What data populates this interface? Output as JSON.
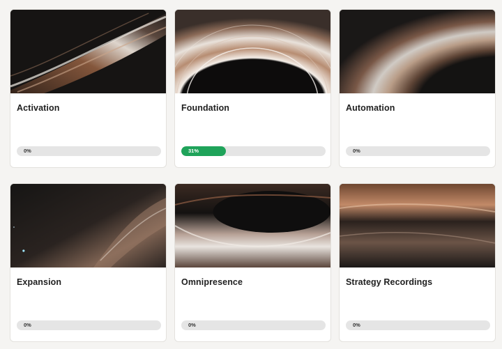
{
  "colors": {
    "page_background": "#f5f4f2",
    "card_background": "#ffffff",
    "progress_track": "#e5e5e5",
    "progress_fill": "#1fa35a"
  },
  "courses": [
    {
      "title": "Activation",
      "progress_label": "0%",
      "progress": 0,
      "thumbnail_icon": "black-hole-image"
    },
    {
      "title": "Foundation",
      "progress_label": "31%",
      "progress": 31,
      "thumbnail_icon": "black-hole-image"
    },
    {
      "title": "Automation",
      "progress_label": "0%",
      "progress": 0,
      "thumbnail_icon": "black-hole-image"
    },
    {
      "title": "Expansion",
      "progress_label": "0%",
      "progress": 0,
      "thumbnail_icon": "black-hole-image"
    },
    {
      "title": "Omnipresence",
      "progress_label": "0%",
      "progress": 0,
      "thumbnail_icon": "black-hole-image"
    },
    {
      "title": "Strategy Recordings",
      "progress_label": "0%",
      "progress": 0,
      "thumbnail_icon": "black-hole-image"
    }
  ]
}
